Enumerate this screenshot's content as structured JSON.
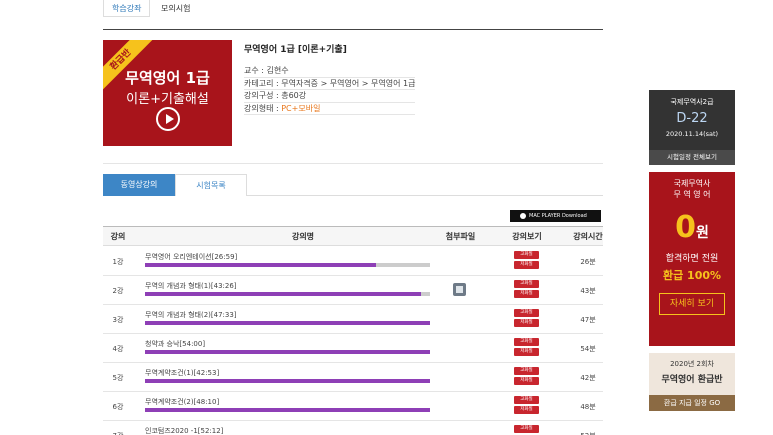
{
  "top_tabs": [
    "학습강좌",
    "모의시험"
  ],
  "thumbnail": {
    "badge": "환급반",
    "line1": "무역영어 1급",
    "line2": "이론+기출해설"
  },
  "course": {
    "title": "무역영어 1급 [이론+기출]",
    "teacher": "교수 : 김현수",
    "category": "카테고리 : 무역자격증 > 무역영어 > 무역영어 1급",
    "composition": "강의구성 : 총60강",
    "format_label": "강의형태 : ",
    "format_value": "PC+모바일"
  },
  "content_tabs": [
    "동영상강의",
    "시험목록"
  ],
  "mac_button": "MAC PLAYER Download",
  "table": {
    "headers": [
      "강의",
      "강의명",
      "첨부파일",
      "강의보기",
      "강의시간"
    ],
    "button_labels": [
      "고화질",
      "저화질"
    ],
    "rows": [
      {
        "num": "1강",
        "name": "무역영어 오리엔테이션[26:59]",
        "progress": 0.81,
        "file": false,
        "duration": "26분"
      },
      {
        "num": "2강",
        "name": "무역의 개념과 형태(1)[43:26]",
        "progress": 0.97,
        "file": true,
        "duration": "43분"
      },
      {
        "num": "3강",
        "name": "무역의 개념과 형태(2)[47:33]",
        "progress": 1.0,
        "file": false,
        "duration": "47분"
      },
      {
        "num": "4강",
        "name": "청약과 승낙[54:00]",
        "progress": 1.0,
        "file": false,
        "duration": "54분"
      },
      {
        "num": "5강",
        "name": "무역계약조건(1)[42:53]",
        "progress": 1.0,
        "file": false,
        "duration": "42분"
      },
      {
        "num": "6강",
        "name": "무역계약조건(2)[48:10]",
        "progress": 1.0,
        "file": false,
        "duration": "48분"
      },
      {
        "num": "7강",
        "name": "인코텀즈2020 -1[52:12]",
        "progress": 0.0,
        "file": false,
        "duration": "52분"
      }
    ]
  },
  "ad_exam": {
    "title": "국제무역사2급",
    "dday": "D-22",
    "date": "2020.11.14(sat)",
    "link": "시험일정 전체보기"
  },
  "ad_refund": {
    "line1": "국제무역사",
    "line2": "무 역 영 어",
    "zero": "0",
    "won": "원",
    "line3": "합격하면 전원",
    "line4": "환급 100%",
    "button": "자세히 보기"
  },
  "ad_round": {
    "line1": "2020년 2회차",
    "line2": "무역영어 환급반",
    "button": "환급 지급 일정 GO"
  }
}
